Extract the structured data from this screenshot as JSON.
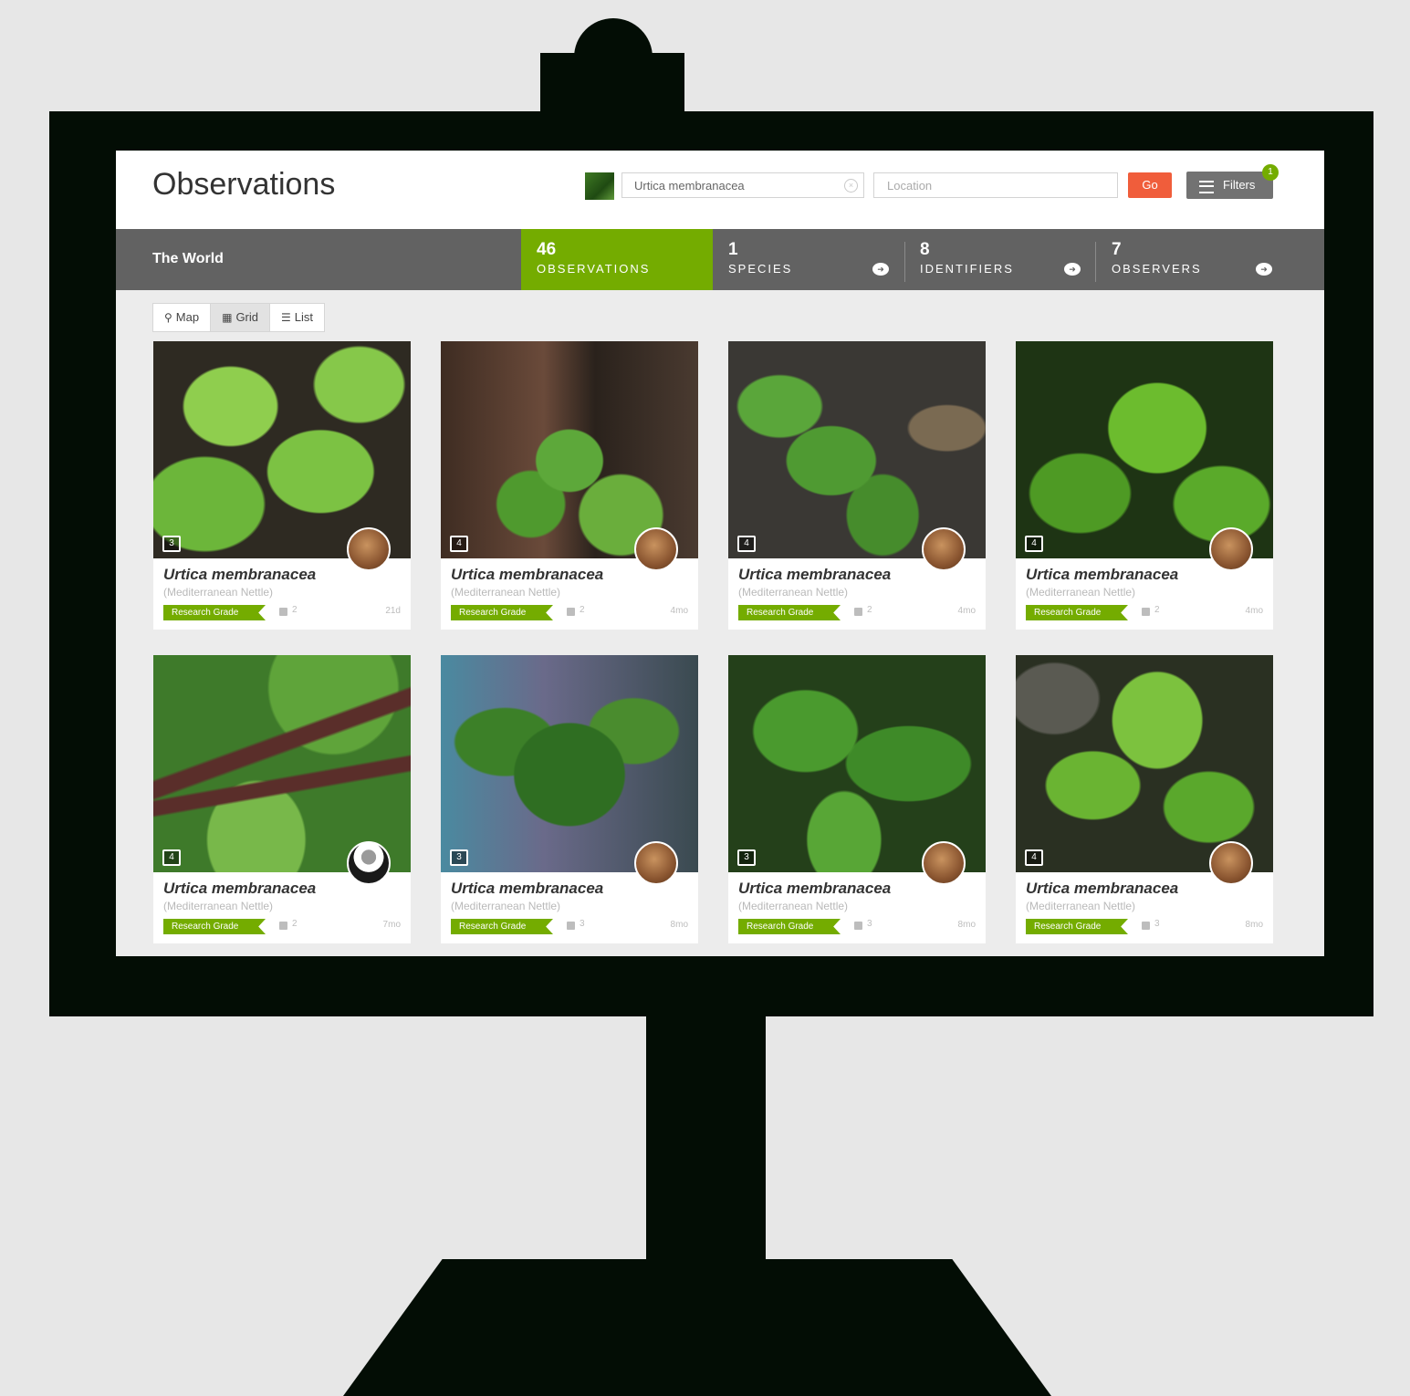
{
  "header": {
    "title": "Observations",
    "search_value": "Urtica membranacea",
    "location_placeholder": "Location",
    "go_label": "Go",
    "filters_label": "Filters",
    "filter_badge": "1"
  },
  "stats": {
    "place": "The World",
    "items": [
      {
        "num": "46",
        "label": "OBSERVATIONS"
      },
      {
        "num": "1",
        "label": "SPECIES"
      },
      {
        "num": "8",
        "label": "IDENTIFIERS"
      },
      {
        "num": "7",
        "label": "OBSERVERS"
      }
    ]
  },
  "view_tabs": [
    {
      "icon": "map-pin-icon",
      "glyph": "📍",
      "label": "Map"
    },
    {
      "icon": "grid-icon",
      "glyph": "▦",
      "label": "Grid"
    },
    {
      "icon": "list-icon",
      "glyph": "☰",
      "label": "List"
    }
  ],
  "observations": [
    {
      "name": "Urtica membranacea",
      "common": "(Mediterranean Nettle)",
      "grade": "Research Grade",
      "comments": "2",
      "time": "21d",
      "photos": "3"
    },
    {
      "name": "Urtica membranacea",
      "common": "(Mediterranean Nettle)",
      "grade": "Research Grade",
      "comments": "2",
      "time": "4mo",
      "photos": "4"
    },
    {
      "name": "Urtica membranacea",
      "common": "(Mediterranean Nettle)",
      "grade": "Research Grade",
      "comments": "2",
      "time": "4mo",
      "photos": "4"
    },
    {
      "name": "Urtica membranacea",
      "common": "(Mediterranean Nettle)",
      "grade": "Research Grade",
      "comments": "2",
      "time": "4mo",
      "photos": "4"
    },
    {
      "name": "Urtica membranacea",
      "common": "(Mediterranean Nettle)",
      "grade": "Research Grade",
      "comments": "2",
      "time": "7mo",
      "photos": "4"
    },
    {
      "name": "Urtica membranacea",
      "common": "(Mediterranean Nettle)",
      "grade": "Research Grade",
      "comments": "3",
      "time": "8mo",
      "photos": "3"
    },
    {
      "name": "Urtica membranacea",
      "common": "(Mediterranean Nettle)",
      "grade": "Research Grade",
      "comments": "3",
      "time": "8mo",
      "photos": "3"
    },
    {
      "name": "Urtica membranacea",
      "common": "(Mediterranean Nettle)",
      "grade": "Research Grade",
      "comments": "3",
      "time": "8mo",
      "photos": "4"
    }
  ],
  "colors": {
    "accent_green": "#74ac00",
    "go_orange": "#f05d3b",
    "stats_bar": "#626262",
    "monitor": "#030d05"
  }
}
